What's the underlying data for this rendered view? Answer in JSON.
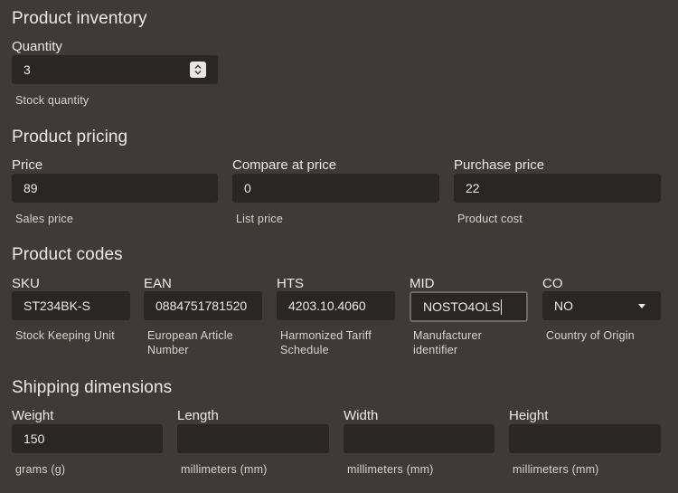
{
  "inventory": {
    "title": "Product inventory",
    "quantity": {
      "label": "Quantity",
      "value": "3",
      "help": "Stock quantity"
    }
  },
  "pricing": {
    "title": "Product pricing",
    "price": {
      "label": "Price",
      "value": "89",
      "help": "Sales price"
    },
    "compare": {
      "label": "Compare at price",
      "value": "0",
      "help": "List price"
    },
    "purchase": {
      "label": "Purchase price",
      "value": "22",
      "help": "Product cost"
    }
  },
  "codes": {
    "title": "Product codes",
    "sku": {
      "label": "SKU",
      "value": "ST234BK-S",
      "help": "Stock Keeping Unit"
    },
    "ean": {
      "label": "EAN",
      "value": "0884751781520",
      "help_line1": "European Article",
      "help_line2": "Number"
    },
    "hts": {
      "label": "HTS",
      "value": "4203.10.4060",
      "help_line1": "Harmonized Tariff",
      "help_line2": "Schedule"
    },
    "mid": {
      "label": "MID",
      "value": "NOSTO4OLS",
      "help_line1": "Manufacturer",
      "help_line2": "identifier"
    },
    "co": {
      "label": "CO",
      "value": "NO",
      "help": "Country of Origin"
    }
  },
  "shipping": {
    "title": "Shipping dimensions",
    "weight": {
      "label": "Weight",
      "value": "150",
      "help": "grams (g)"
    },
    "length": {
      "label": "Length",
      "value": "",
      "help": "millimeters (mm)"
    },
    "width": {
      "label": "Width",
      "value": "",
      "help": "millimeters (mm)"
    },
    "height": {
      "label": "Height",
      "value": "",
      "help": "millimeters (mm)"
    }
  },
  "icons": {
    "stepper": "up-down-stepper-icon",
    "select": "chevron-down-icon"
  },
  "colors": {
    "background": "#3f3a37",
    "input_background": "#2a2624",
    "text": "#ece9e6",
    "focus_border": "#6e6965"
  }
}
